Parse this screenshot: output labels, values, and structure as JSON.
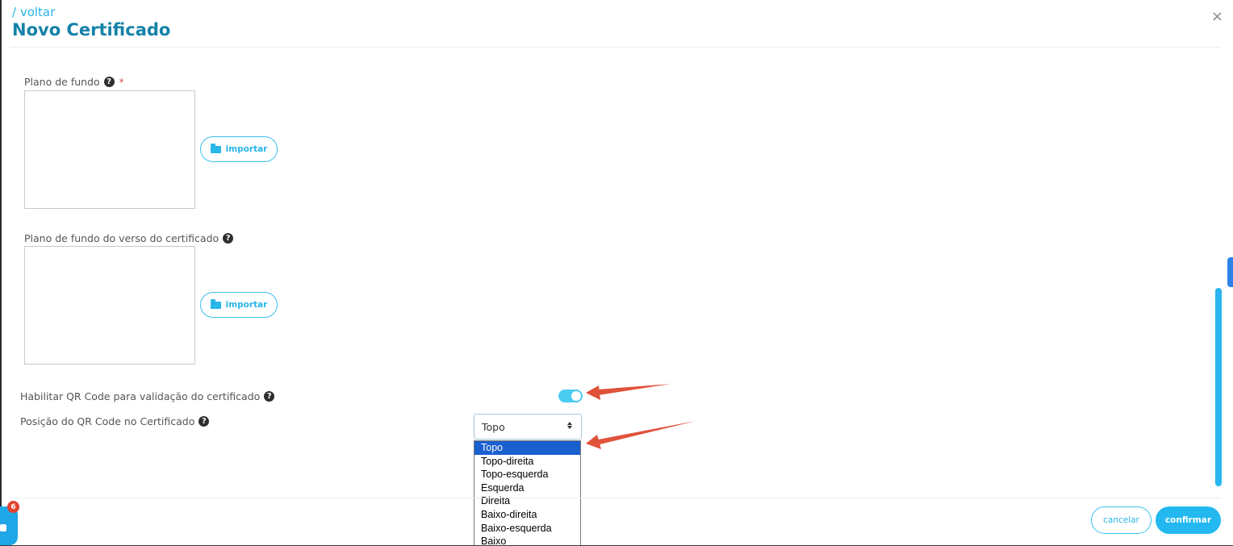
{
  "header": {
    "back_label": "/ voltar",
    "title": "Novo Certificado",
    "close_label": "×"
  },
  "background_front": {
    "label": "Plano de fundo",
    "required_mark": "*",
    "import_label": "importar"
  },
  "background_back": {
    "label": "Plano de fundo do verso do certificado",
    "import_label": "importar"
  },
  "qr_enable": {
    "label": "Habilitar QR Code para validação do certificado",
    "enabled": true
  },
  "qr_position": {
    "label": "Posição do QR Code no Certificado",
    "selected": "Topo",
    "options": [
      "Topo",
      "Topo-direita",
      "Topo-esquerda",
      "Esquerda",
      "Direita",
      "Baixo-direita",
      "Baixo-esquerda",
      "Baixo"
    ]
  },
  "footer": {
    "cancel_label": "cancelar",
    "confirm_label": "confirmar"
  },
  "chat": {
    "badge_count": "6"
  },
  "icons": {
    "help": "question-circle-icon",
    "folder": "folder-open-icon",
    "close": "close-icon"
  },
  "colors": {
    "accent": "#29b6e8",
    "title": "#1482a8",
    "primary_button": "#23b9f0",
    "selected_option": "#1a5fd0",
    "annotation_arrow": "#e0523a",
    "badge": "#e0432f"
  }
}
